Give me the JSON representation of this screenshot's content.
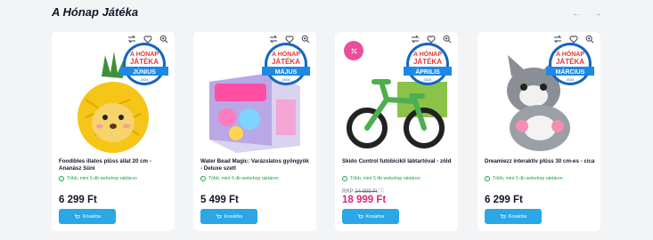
{
  "section": {
    "title": "A Hónap Játéka"
  },
  "nav": {
    "prev_icon": "arrow-left-icon",
    "next_icon": "arrow-right-icon"
  },
  "colors": {
    "accent": "#2aa7e4",
    "sale": "#db2777",
    "stock": "#16a34a",
    "badge_blue": "#1e88e5",
    "badge_red": "#e53935"
  },
  "badges": {
    "line1": "A HÓNAP",
    "line2": "JÁTÉKA",
    "year": "2024"
  },
  "cart_label": "Kosárba",
  "products": [
    {
      "name": "Foodibles illatos plüss állat 20 cm - Ananász Süni",
      "stock": "Több, mint 5 db webshop raktáron",
      "old_price": "",
      "price": "6 299 Ft",
      "month": "JÚNIUS",
      "sale": false
    },
    {
      "name": "Water Bead Magic: Varázslatos gyöngyök - Deluxe szett",
      "stock": "Több, mint 5 db webshop raktáron",
      "old_price": "",
      "price": "5 499 Ft",
      "month": "MÁJUS",
      "sale": false
    },
    {
      "name": "Skido Control futóbicikli lábtartóval - zöld",
      "stock": "Több, mint 5 db webshop raktáron",
      "old_price_label": "RRP",
      "old_price": "24 999 Ft",
      "price": "18 999 Ft",
      "month": "ÁPRILIS",
      "sale": true
    },
    {
      "name": "Dreamiezz interaktív plüss 30 cm-es - cica",
      "stock": "Több, mint 5 db webshop raktáron",
      "old_price": "",
      "price": "6 299 Ft",
      "month": "MÁRCIUS",
      "sale": false
    }
  ]
}
